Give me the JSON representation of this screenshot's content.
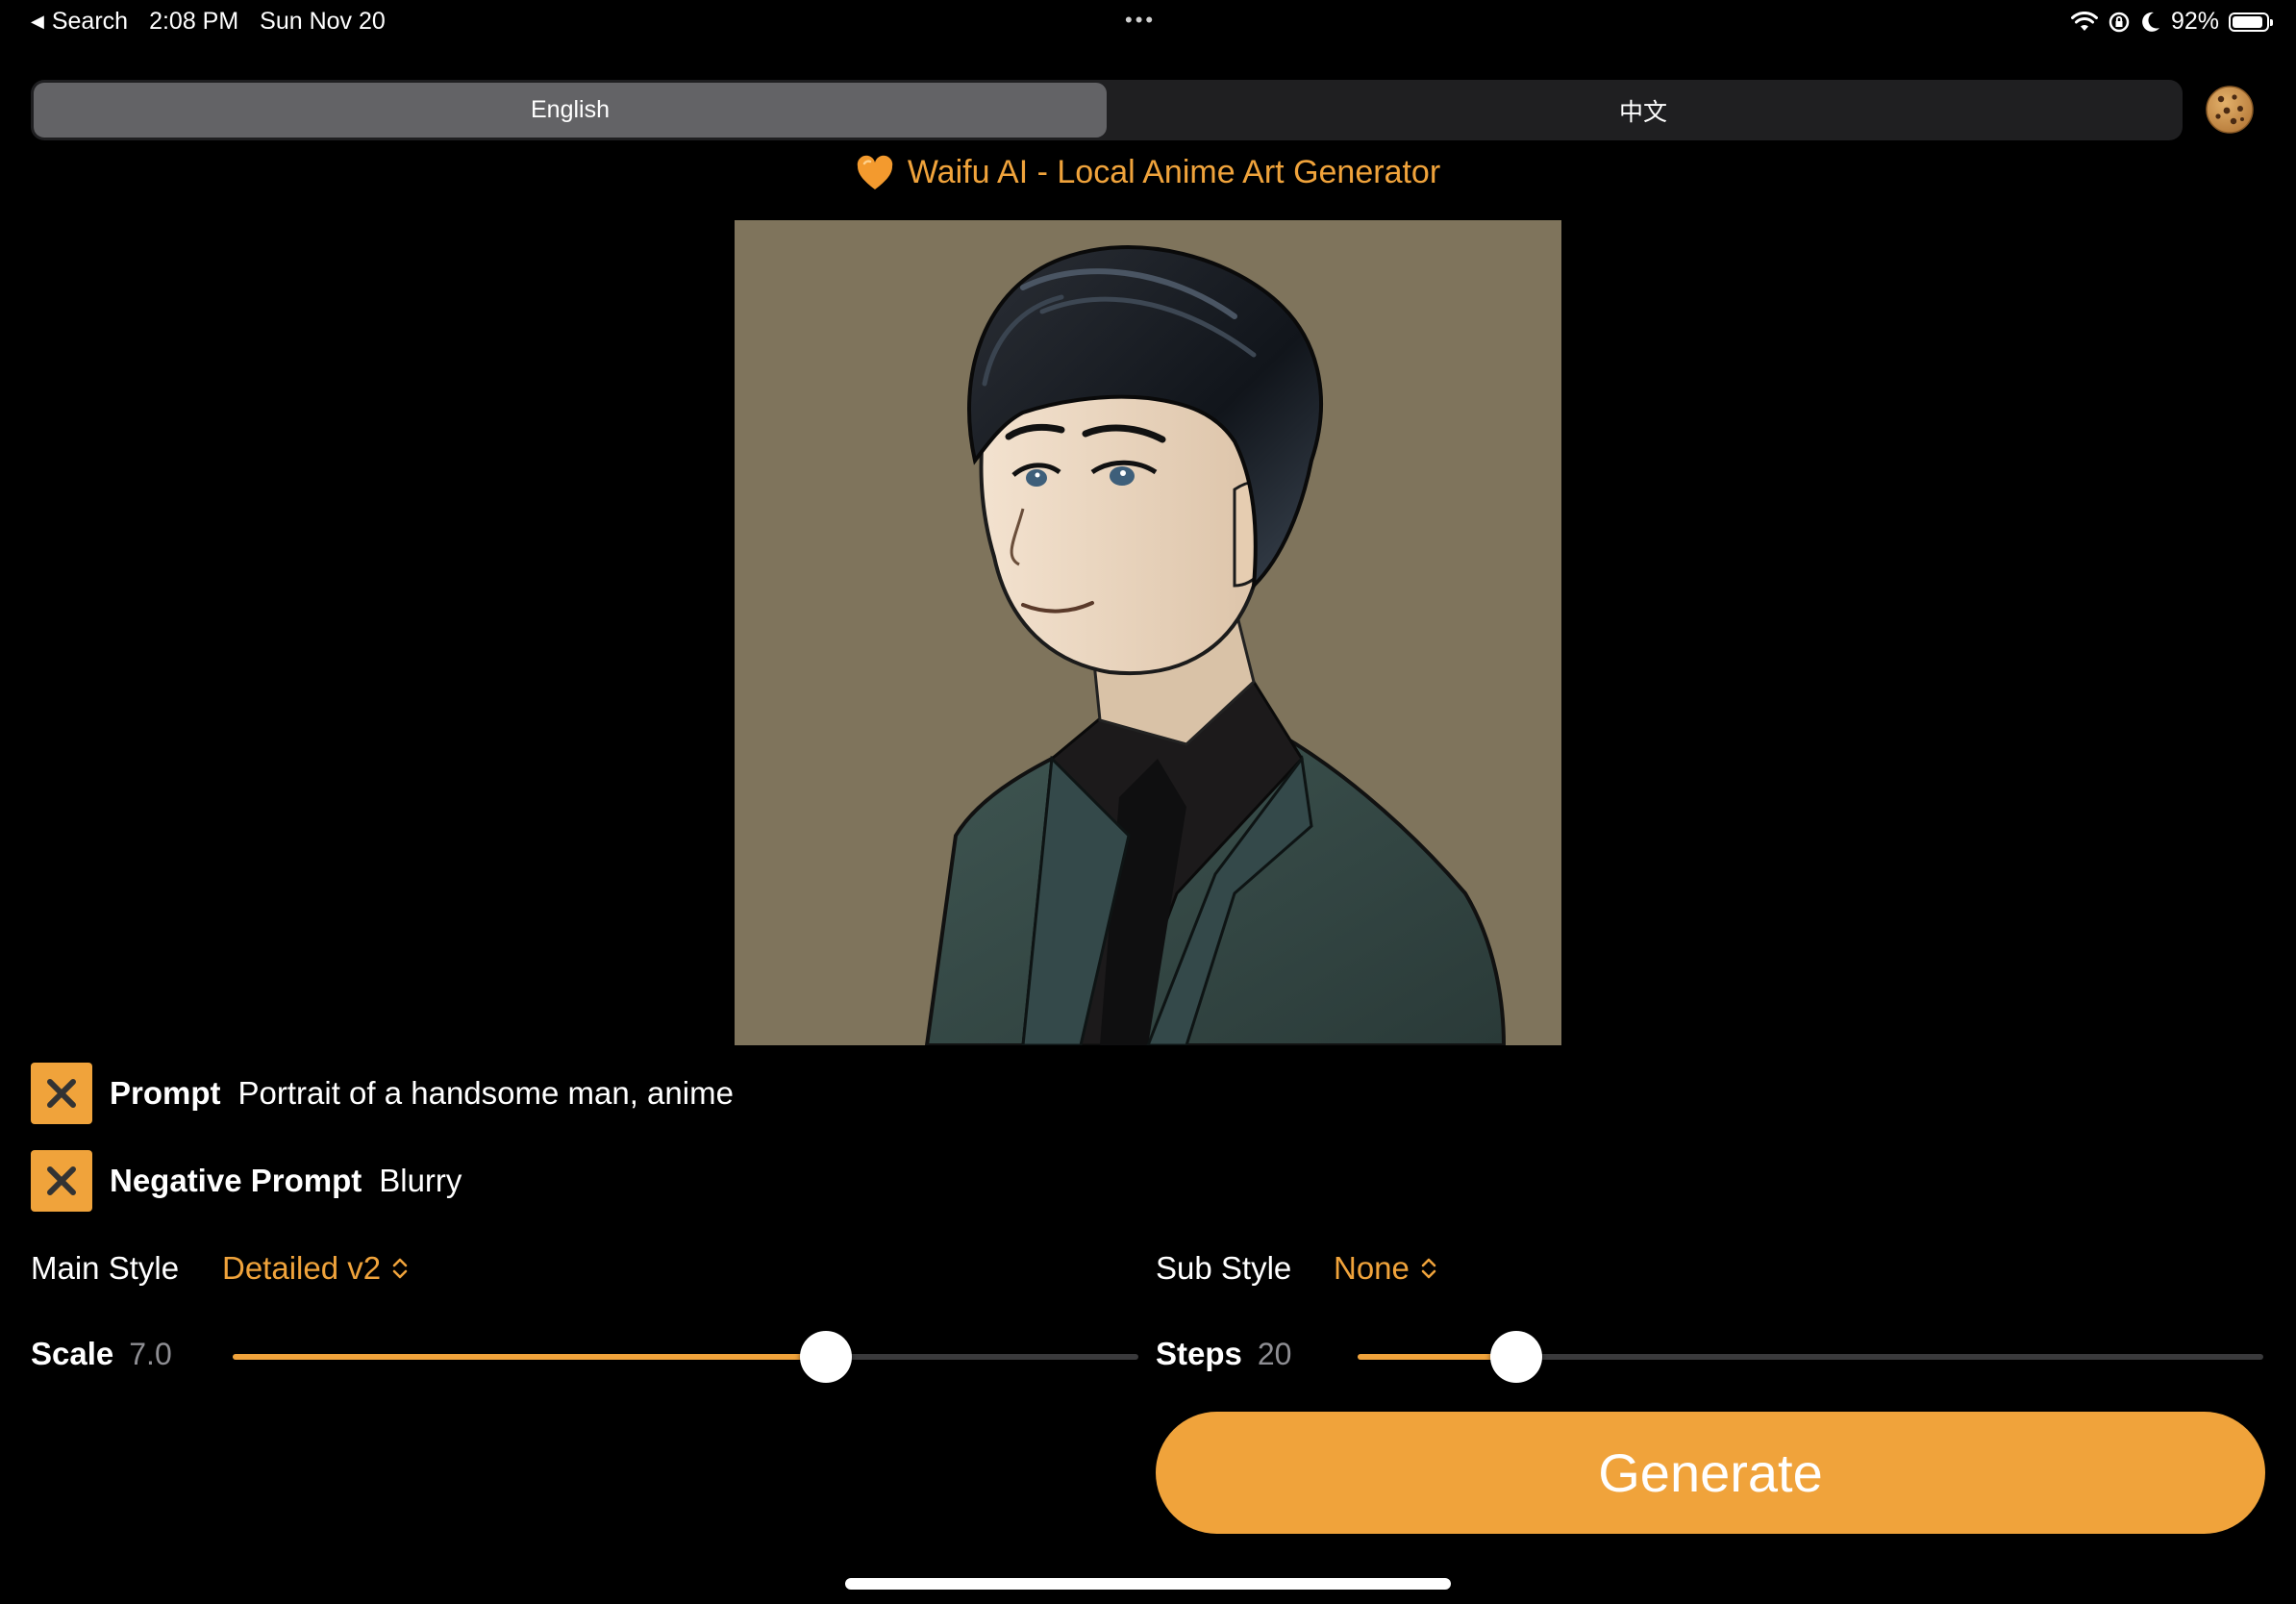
{
  "status_bar": {
    "back_label": "Search",
    "time": "2:08 PM",
    "date": "Sun Nov 20",
    "battery": "92%",
    "battery_level": 0.92,
    "icons": [
      "wifi-icon",
      "screen-lock-rotation-icon",
      "moon-icon",
      "battery-icon"
    ]
  },
  "language_tabs": {
    "items": [
      {
        "label": "English",
        "active": true
      },
      {
        "label": "中文",
        "active": false
      }
    ]
  },
  "header": {
    "title": "Waifu AI - Local Anime Art Generator",
    "icon": "orange-heart-icon"
  },
  "prompt": {
    "label": "Prompt",
    "value": "Portrait of a handsome man, anime"
  },
  "negative_prompt": {
    "label": "Negative Prompt",
    "value": "Blurry"
  },
  "main_style": {
    "label": "Main Style",
    "value": "Detailed v2"
  },
  "sub_style": {
    "label": "Sub Style",
    "value": "None"
  },
  "scale": {
    "label": "Scale",
    "value": "7.0",
    "fraction": 0.655
  },
  "steps": {
    "label": "Steps",
    "value": "20",
    "fraction": 0.175
  },
  "generate": {
    "label": "Generate"
  },
  "colors": {
    "accent": "#F0A33B",
    "background": "#000000",
    "segment_active": "#636366",
    "segment_bg": "#1F1F21"
  }
}
